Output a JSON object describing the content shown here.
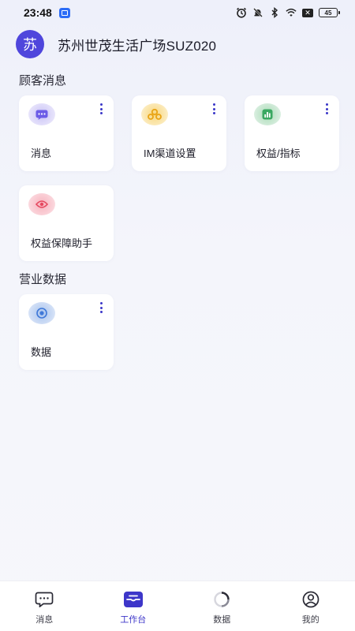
{
  "status_bar": {
    "time": "23:48",
    "battery": "45"
  },
  "header": {
    "avatar_text": "苏",
    "store_name": "苏州世茂生活广场SUZ020"
  },
  "sections": {
    "customer_messages": {
      "title": "顾客消息",
      "cards": [
        {
          "label": "消息",
          "icon": "chat-bubble-icon",
          "color": "#6c5ce7"
        },
        {
          "label": "IM渠道设置",
          "icon": "im-settings-icon",
          "color": "#f0b429"
        },
        {
          "label": "权益/指标",
          "icon": "bar-chart-icon",
          "color": "#3aa861"
        },
        {
          "label": "权益保障助手",
          "icon": "eye-shield-icon",
          "color": "#e5485f"
        }
      ]
    },
    "business_data": {
      "title": "营业数据",
      "cards": [
        {
          "label": "数据",
          "icon": "data-eye-icon",
          "color": "#3f78d8"
        }
      ]
    }
  },
  "bottom_nav": {
    "items": [
      {
        "label": "消息",
        "icon": "message-icon",
        "active": false
      },
      {
        "label": "工作台",
        "icon": "workbench-icon",
        "active": true
      },
      {
        "label": "数据",
        "icon": "data-ring-icon",
        "active": false
      },
      {
        "label": "我的",
        "icon": "profile-icon",
        "active": false
      }
    ]
  },
  "colors": {
    "accent": "#3d36c9",
    "avatar": "#4f46dc"
  }
}
